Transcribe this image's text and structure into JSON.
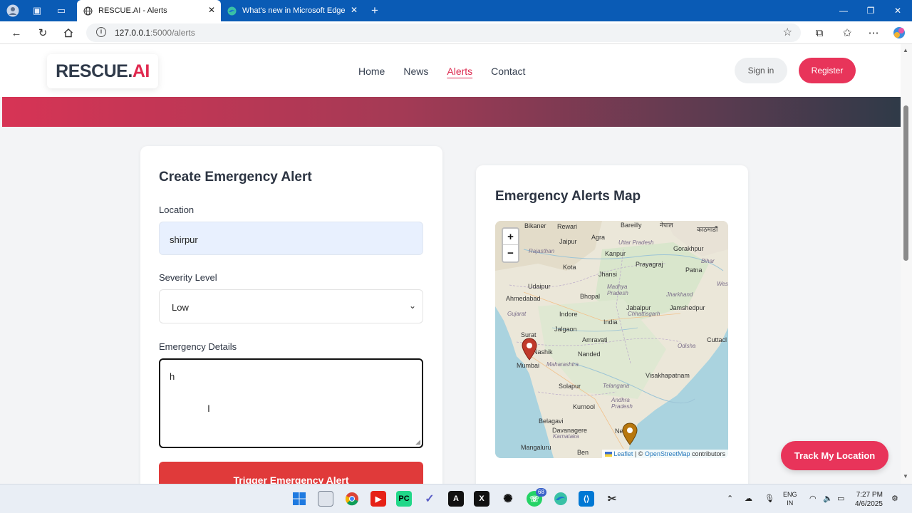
{
  "browser": {
    "tabs": [
      {
        "title": "RESCUE.AI - Alerts",
        "active": true
      },
      {
        "title": "What's new in Microsoft Edge",
        "active": false
      }
    ],
    "url_host": "127.0.0.1",
    "url_path": ":5000/alerts"
  },
  "site": {
    "logo_part1": "RESCUE.",
    "logo_part2": "AI",
    "nav": [
      "Home",
      "News",
      "Alerts",
      "Contact"
    ],
    "signin_label": "Sign in",
    "register_label": "Register"
  },
  "form": {
    "title": "Create Emergency Alert",
    "location_label": "Location",
    "location_value": "shirpur",
    "severity_label": "Severity Level",
    "severity_value": "Low",
    "details_label": "Emergency Details",
    "details_value": "h",
    "submit_label": "Trigger Emergency Alert"
  },
  "map_card": {
    "title": "Emergency Alerts Map",
    "zoom_in": "+",
    "zoom_out": "−",
    "attribution": {
      "leaflet": "Leaflet",
      "sep": " | © ",
      "osm": "OpenStreetMap",
      "tail": " contributors"
    },
    "cities": [
      "Bikaner",
      "Rewari",
      "Bareilly",
      "नेपाल",
      "काठमाडौं",
      "Jaipur",
      "Agra",
      "Uttar Pradesh",
      "Gorakhpur",
      "Rajasthan",
      "Kanpur",
      "Bihar",
      "Kota",
      "Jhansi",
      "Prayagraj",
      "Patna",
      "Udaipur",
      "Madhya Pradesh",
      "Jharkhand",
      "Ahmedabad",
      "Bhopal",
      "Jabalpur",
      "Jamshedpur",
      "Gujarat",
      "Indore",
      "India",
      "Wes",
      "Chhattisgarh",
      "Jalgaon",
      "Surat",
      "Amravati",
      "Nashik",
      "Odisha",
      "Cuttacl",
      "Nanded",
      "Mumbai",
      "Maharashtra",
      "Telangana",
      "Visakhapatnam",
      "Solapur",
      "Belagavi",
      "Kurnool",
      "Andhra Pradesh",
      "Karnataka",
      "Davanagere",
      "Nel",
      "Mangaluru",
      "Ben"
    ],
    "markers": [
      {
        "label": "red alert marker",
        "color": "#c0392b"
      },
      {
        "label": "orange alert marker",
        "color": "#b7770e"
      }
    ]
  },
  "track_label": "Track My Location",
  "taskbar": {
    "lang1": "ENG",
    "lang2": "IN",
    "time": "7:27 PM",
    "date": "4/6/2025",
    "badge": "68"
  }
}
